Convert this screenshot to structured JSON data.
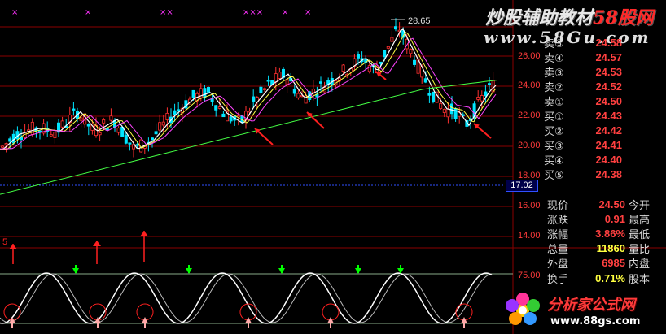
{
  "watermark": {
    "title_prefix": "炒股辅助教材",
    "title_brand": "58股网",
    "url": "www.58Gu.com",
    "logo_text": "分析家公式网",
    "logo_url": "www.88gs.com"
  },
  "chart": {
    "peak_label": "28.65",
    "current_price_label": "17.02",
    "price_axis_labels": [
      "26.00",
      "24.00",
      "22.00",
      "20.00",
      "18.00",
      "16.00",
      "14.00"
    ],
    "oscillator_axis_label": "75.00",
    "colors": {
      "up_candle": "#ff3030",
      "down_candle": "#00e5ff",
      "ma5": "#ffffff",
      "ma10": "#ffff44",
      "ma20": "#ff44ff",
      "ma60": "#44ff44",
      "arrow": "#ff2020",
      "buy_mark": "#00ff00",
      "grid": "#8b0000",
      "signal_x": "#ff33ff"
    },
    "top_markers": [
      "×",
      "×",
      "××",
      "×××",
      "×",
      "×"
    ]
  },
  "order_book": [
    {
      "label": "卖⑤",
      "value": "24.58"
    },
    {
      "label": "卖④",
      "value": "24.57"
    },
    {
      "label": "卖③",
      "value": "24.53"
    },
    {
      "label": "卖②",
      "value": "24.52"
    },
    {
      "label": "卖①",
      "value": "24.50"
    },
    {
      "label": "买①",
      "value": "24.43"
    },
    {
      "label": "买②",
      "value": "24.42"
    },
    {
      "label": "买③",
      "value": "24.41"
    },
    {
      "label": "买④",
      "value": "24.40"
    },
    {
      "label": "买⑤",
      "value": "24.38"
    }
  ],
  "quote": [
    {
      "label": "现价",
      "value": "24.50",
      "label2": "今开",
      "color": "#ff4040"
    },
    {
      "label": "涨跌",
      "value": "0.91",
      "label2": "最高",
      "color": "#ff4040"
    },
    {
      "label": "涨幅",
      "value": "3.86%",
      "label2": "最低",
      "color": "#ff4040"
    },
    {
      "label": "总量",
      "value": "11860",
      "label2": "量比",
      "color": "#ffff40"
    },
    {
      "label": "外盘",
      "value": "6985",
      "label2": "内盘",
      "color": "#ff4040"
    },
    {
      "label": "换手",
      "value": "0.71%",
      "label2": "股本",
      "color": "#ffff40"
    }
  ]
}
